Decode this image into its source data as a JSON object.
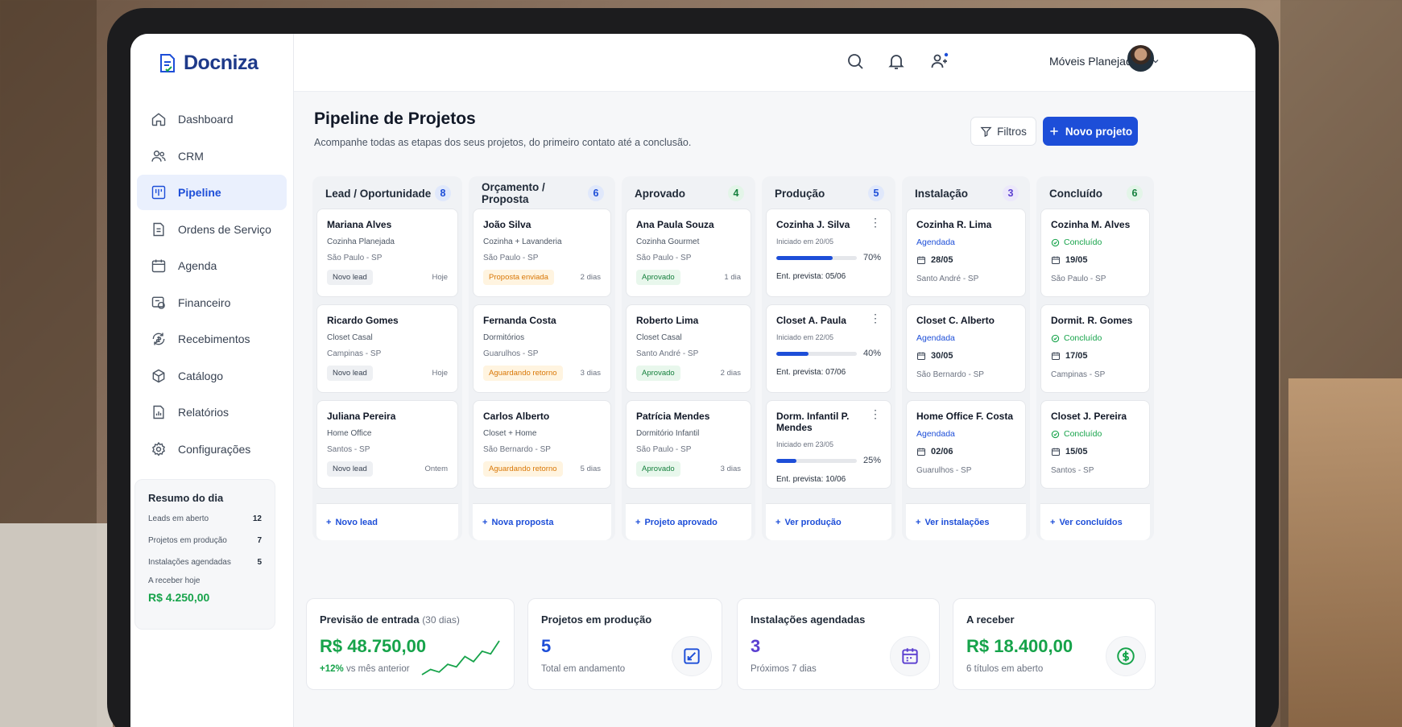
{
  "app": {
    "name": "Docniza",
    "brand_color": "#1d4ed8",
    "company": "Móveis Planejados"
  },
  "sidebar": {
    "items": [
      {
        "label": "Dashboard",
        "icon": "home-icon"
      },
      {
        "label": "CRM",
        "icon": "users-icon"
      },
      {
        "label": "Pipeline",
        "icon": "kanban-icon",
        "active": true
      },
      {
        "label": "Ordens de Serviço",
        "icon": "document-icon"
      },
      {
        "label": "Agenda",
        "icon": "calendar-icon"
      },
      {
        "label": "Financeiro",
        "icon": "money-icon"
      },
      {
        "label": "Recebimentos",
        "icon": "refresh-money-icon"
      },
      {
        "label": "Catálogo",
        "icon": "box-icon"
      },
      {
        "label": "Relatórios",
        "icon": "report-icon"
      },
      {
        "label": "Configurações",
        "icon": "gear-icon"
      }
    ],
    "summary": {
      "title": "Resumo do dia",
      "rows": [
        {
          "label": "Leads em aberto",
          "value": "12"
        },
        {
          "label": "Projetos em produção",
          "value": "7"
        },
        {
          "label": "Instalações agendadas",
          "value": "5"
        }
      ],
      "receive_label": "A receber hoje",
      "receive_value": "R$ 4.250,00"
    }
  },
  "page": {
    "title": "Pipeline de Projetos",
    "subtitle": "Acompanhe todas as etapas dos seus projetos, do primeiro contato até a conclusão.",
    "filter_label": "Filtros",
    "new_label": "Novo projeto"
  },
  "columns": [
    {
      "title": "Lead / Oportunidade",
      "count": "8",
      "count_color": "#1d4ed8",
      "count_bg": "#e0e8fb",
      "link": "Novo lead",
      "cards": [
        {
          "name": "Mariana Alves",
          "l1": "Cozinha Planejada",
          "l2": "São Paulo - SP",
          "tag": "Novo lead",
          "tag_style": "gray",
          "when": "Hoje"
        },
        {
          "name": "Ricardo Gomes",
          "l1": "Closet Casal",
          "l2": "Campinas - SP",
          "tag": "Novo lead",
          "tag_style": "gray",
          "when": "Hoje"
        },
        {
          "name": "Juliana Pereira",
          "l1": "Home Office",
          "l2": "Santos - SP",
          "tag": "Novo lead",
          "tag_style": "gray",
          "when": "Ontem"
        }
      ]
    },
    {
      "title": "Orçamento / Proposta",
      "count": "6",
      "count_color": "#1d4ed8",
      "count_bg": "#e0e8fb",
      "link": "Nova proposta",
      "cards": [
        {
          "name": "João Silva",
          "l1": "Cozinha + Lavanderia",
          "l2": "São Paulo - SP",
          "tag": "Proposta enviada",
          "tag_style": "orange",
          "when": "2 dias"
        },
        {
          "name": "Fernanda Costa",
          "l1": "Dormitórios",
          "l2": "Guarulhos - SP",
          "tag": "Aguardando retorno",
          "tag_style": "orange",
          "when": "3 dias"
        },
        {
          "name": "Carlos Alberto",
          "l1": "Closet + Home",
          "l2": "São Bernardo - SP",
          "tag": "Aguardando retorno",
          "tag_style": "orange",
          "when": "5 dias"
        }
      ]
    },
    {
      "title": "Aprovado",
      "count": "4",
      "count_color": "#15803d",
      "count_bg": "#e3f5e8",
      "link": "Projeto aprovado",
      "cards": [
        {
          "name": "Ana Paula Souza",
          "l1": "Cozinha Gourmet",
          "l2": "São Paulo - SP",
          "tag": "Aprovado",
          "tag_style": "green",
          "when": "1 dia"
        },
        {
          "name": "Roberto Lima",
          "l1": "Closet Casal",
          "l2": "Santo André - SP",
          "tag": "Aprovado",
          "tag_style": "green",
          "when": "2 dias"
        },
        {
          "name": "Patrícia Mendes",
          "l1": "Dormitório Infantil",
          "l2": "São Paulo - SP",
          "tag": "Aprovado",
          "tag_style": "green",
          "when": "3 dias"
        }
      ]
    },
    {
      "title": "Produção",
      "count": "5",
      "count_color": "#1d4ed8",
      "count_bg": "#e0e8fb",
      "link": "Ver produção",
      "cards": [
        {
          "name": "Cozinha J. Silva",
          "started": "Iniciado em 20/05",
          "progress": 70,
          "progress_label": "70%",
          "due": "Ent. prevista: 05/06"
        },
        {
          "name": "Closet A. Paula",
          "started": "Iniciado em 22/05",
          "progress": 40,
          "progress_label": "40%",
          "due": "Ent. prevista: 07/06"
        },
        {
          "name": "Dorm. Infantil P. Mendes",
          "started": "Iniciado em 23/05",
          "progress": 25,
          "progress_label": "25%",
          "due": "Ent. prevista: 10/06"
        }
      ]
    },
    {
      "title": "Instalação",
      "count": "3",
      "count_color": "#5b3fd0",
      "count_bg": "#ece8fb",
      "link": "Ver instalações",
      "cards": [
        {
          "name": "Cozinha R. Lima",
          "status": "Agendada",
          "date": "28/05",
          "place": "Santo André - SP"
        },
        {
          "name": "Closet C. Alberto",
          "status": "Agendada",
          "date": "30/05",
          "place": "São Bernardo - SP"
        },
        {
          "name": "Home Office F. Costa",
          "status": "Agendada",
          "date": "02/06",
          "place": "Guarulhos - SP"
        }
      ]
    },
    {
      "title": "Concluído",
      "count": "6",
      "count_color": "#15803d",
      "count_bg": "#e3f5e8",
      "link": "Ver concluídos",
      "cards": [
        {
          "name": "Cozinha M. Alves",
          "status": "Concluído",
          "date": "19/05",
          "place": "São Paulo - SP"
        },
        {
          "name": "Dormit. R. Gomes",
          "status": "Concluído",
          "date": "17/05",
          "place": "Campinas - SP"
        },
        {
          "name": "Closet J. Pereira",
          "status": "Concluído",
          "date": "15/05",
          "place": "Santos - SP"
        }
      ]
    }
  ],
  "kpis": {
    "forecast": {
      "title": "Previsão de entrada",
      "period": "(30 dias)",
      "value": "R$ 48.750,00",
      "delta": "+12%",
      "delta_text": "vs mês anterior",
      "trend": [
        3,
        5,
        4,
        7,
        6,
        10,
        8,
        12,
        11,
        16
      ]
    },
    "production": {
      "title": "Projetos em produção",
      "value": "5",
      "sub": "Total em andamento"
    },
    "installs": {
      "title": "Instalações agendadas",
      "value": "3",
      "sub": "Próximos 7 dias"
    },
    "receivable": {
      "title": "A receber",
      "value": "R$ 18.400,00",
      "sub": "6 títulos em aberto"
    }
  }
}
